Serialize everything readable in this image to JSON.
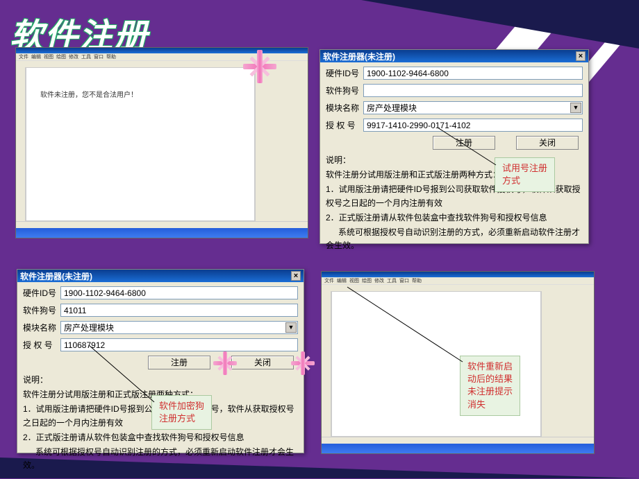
{
  "slide": {
    "title": "软件注册"
  },
  "app_mock": {
    "menus": [
      "文件",
      "编辑",
      "视图",
      "绘图",
      "修改",
      "工具",
      "窗口",
      "帮助"
    ],
    "unreg_msg": "软件未注册，您不是合法用户！"
  },
  "dialogA": {
    "title": "软件注册器(未注册)",
    "fields": {
      "hw_label": "硬件ID号",
      "hw_value": "1900-1102-9464-6800",
      "dog_label": "软件狗号",
      "dog_value": "",
      "mod_label": "模块名称",
      "mod_value": "房产处理模块",
      "auth_label": "授 权 号",
      "auth_value": "9917-1410-2990-0171-4102"
    },
    "btn_reg": "注册",
    "btn_close": "关闭",
    "expl_heading": "说明：",
    "expl1": "软件注册分试用版注册和正式版注册两种方式：",
    "expl2": "1．试用版注册请把硬件ID号报到公司获取软件授权号，软件从获取授权号之日起的一个月内注册有效",
    "expl3": "2．正式版注册请从软件包装盒中查找软件狗号和授权号信息",
    "expl4": "系统可根据授权号自动识别注册的方式，必须重新启动软件注册才会生效。"
  },
  "dialogB": {
    "title": "软件注册器(未注册)",
    "fields": {
      "hw_label": "硬件ID号",
      "hw_value": "1900-1102-9464-6800",
      "dog_label": "软件狗号",
      "dog_value": "41011",
      "mod_label": "模块名称",
      "mod_value": "房产处理模块",
      "auth_label": "授 权 号",
      "auth_value": "110687912"
    },
    "btn_reg": "注册",
    "btn_close": "关闭",
    "expl_heading": "说明：",
    "expl1": "软件注册分试用版注册和正式版注册两种方式：",
    "expl2": "1．试用版注册请把硬件ID号报到公司获取软件授权号，软件从获取授权号之日起的一个月内注册有效",
    "expl3": "2．正式版注册请从软件包装盒中查找软件狗号和授权号信息",
    "expl4": "系统可根据授权号自动识别注册的方式，必须重新启动软件注册才会生效。"
  },
  "callouts": {
    "trial": "试用号注册\n方式",
    "dongle": "软件加密狗\n注册方式",
    "restart": "软件重新启\n动后的结果\n未注册提示\n消失"
  }
}
